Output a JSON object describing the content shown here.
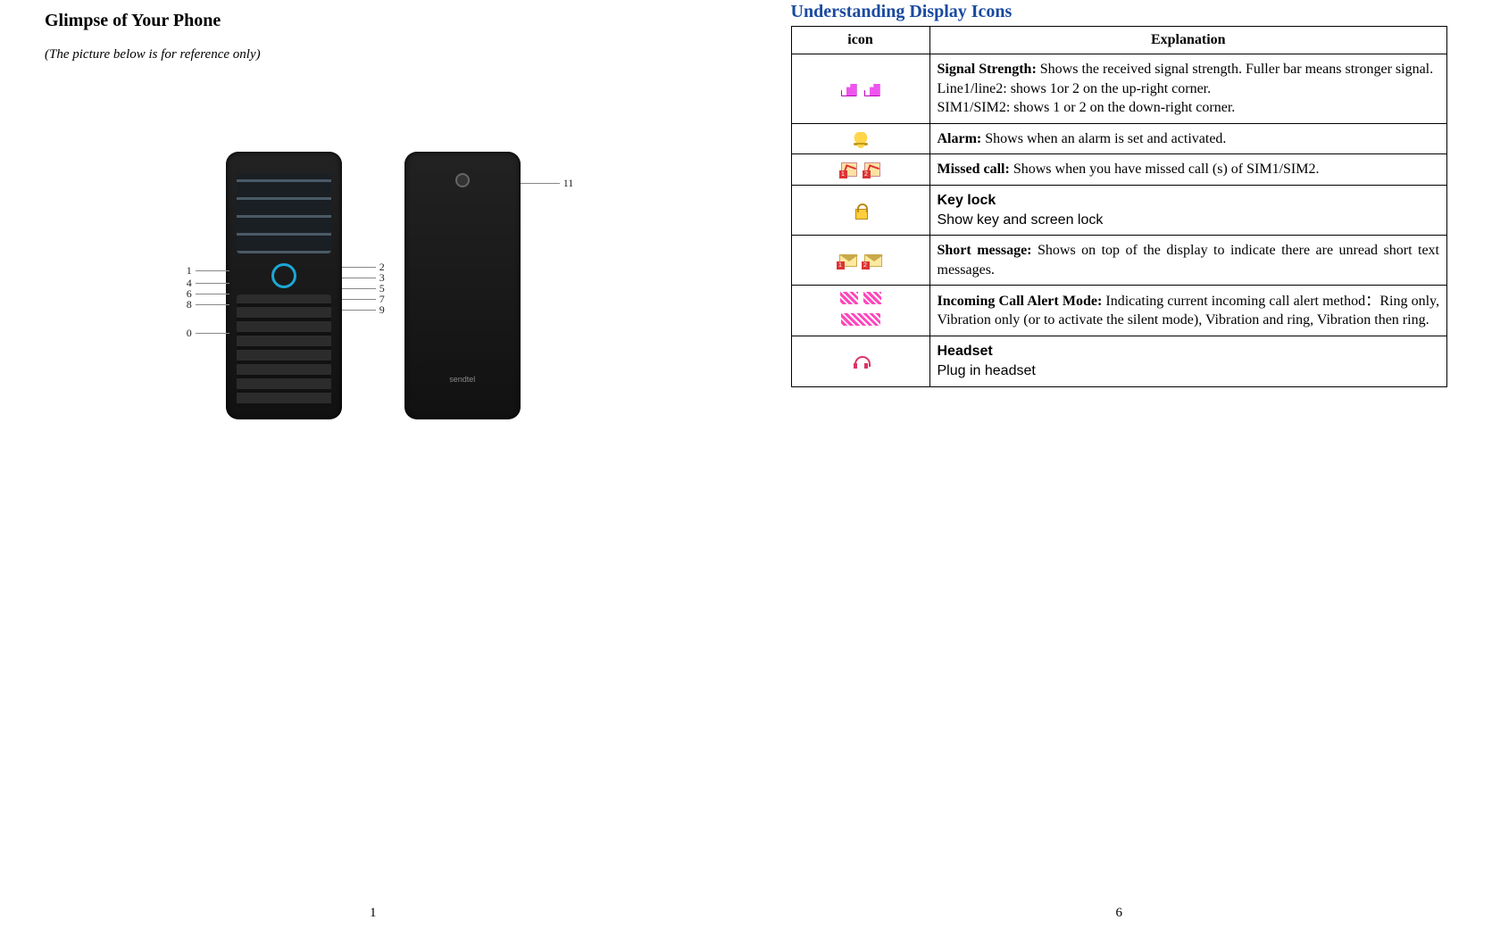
{
  "left": {
    "title": "Glimpse of Your Phone",
    "subtitle": "(The picture below is for reference only)",
    "page_number": "1",
    "callouts": {
      "c0": "0",
      "c1": "1",
      "c2": "2",
      "c3": "3",
      "c4": "4",
      "c5": "5",
      "c6": "6",
      "c7": "7",
      "c8": "8",
      "c9": "9",
      "c11": "11"
    },
    "back_brand": "sendtel"
  },
  "right": {
    "title": "Understanding Display Icons",
    "page_number": "6",
    "headers": {
      "icon": "icon",
      "explanation": "Explanation"
    },
    "rows": [
      {
        "bold": "Signal Strength:",
        "text": " Shows the received signal strength. Fuller bar means stronger signal.",
        "line2": "Line1/line2: shows 1or 2 on the up-right corner.",
        "line3": "SIM1/SIM2: shows 1 or 2 on the down-right corner."
      },
      {
        "bold": "Alarm:",
        "text": " Shows when an alarm is set and activated."
      },
      {
        "bold": "Missed call:",
        "text": " Shows when you have missed call (s) of SIM1/SIM2.",
        "tag1": "1",
        "tag2": "2"
      },
      {
        "bold_sans": "Key lock",
        "sans_text": "Show key and screen lock"
      },
      {
        "bold": "Short message:",
        "text": " Shows on top of the display to indicate there are unread short text messages.",
        "tag1": "1",
        "tag2": "2"
      },
      {
        "bold": "Incoming Call Alert Mode:",
        "text": " Indicating current incoming call alert method：Ring only, Vibration only (or to activate the silent mode), Vibration and ring, Vibration then ring."
      },
      {
        "bold_sans": "Headset",
        "sans_text": "Plug in headset"
      }
    ]
  }
}
